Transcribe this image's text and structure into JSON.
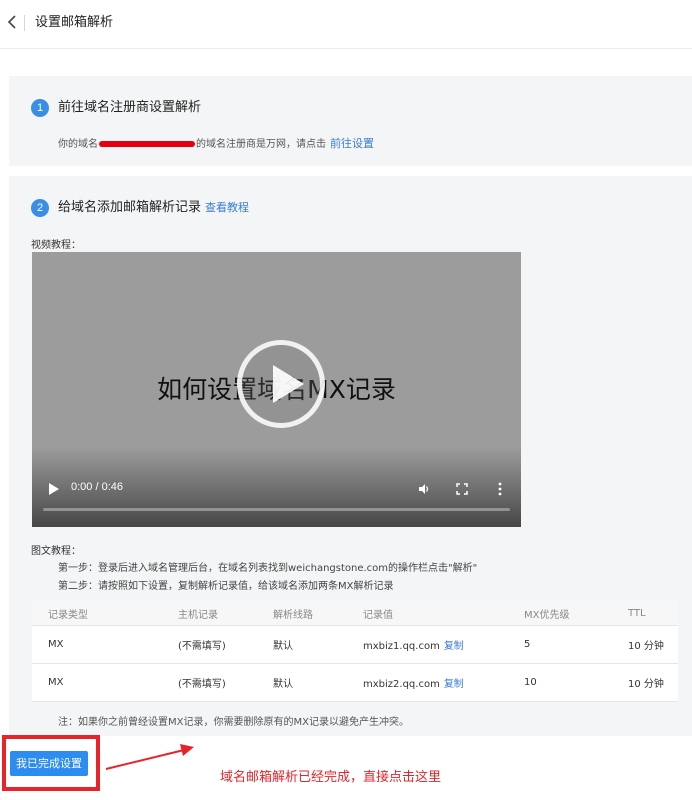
{
  "header": {
    "title": "设置邮箱解析"
  },
  "step1": {
    "number": "1",
    "title": "前往域名注册商设置解析",
    "desc_prefix": "你的域名",
    "desc_suffix": "的域名注册商是万网，请点击",
    "link": "前往设置"
  },
  "step2": {
    "number": "2",
    "title": "给域名添加邮箱解析记录",
    "tutorial_link": "查看教程",
    "video_label": "视频教程：",
    "video": {
      "caption": "如何设置域名MX记录",
      "time": "0:00 / 0:46",
      "progress": 0
    },
    "text_label": "图文教程：",
    "step_a": "第一步：登录后进入域名管理后台，在域名列表找到weichangstone.com的操作栏点击\"解析\"",
    "step_b": "第二步：请按照如下设置，复制解析记录值，给该域名添加两条MX解析记录",
    "table": {
      "headers": [
        "记录类型",
        "主机记录",
        "解析线路",
        "记录值",
        "MX优先级",
        "TTL"
      ],
      "copy_label": "复制",
      "rows": [
        [
          "MX",
          "(不需填写)",
          "默认",
          "mxbiz1.qq.com",
          "5",
          "10 分钟"
        ],
        [
          "MX",
          "(不需填写)",
          "默认",
          "mxbiz2.qq.com",
          "10",
          "10 分钟"
        ]
      ]
    },
    "note": "注：如果你之前曾经设置MX记录，你需要删除原有的MX记录以避免产生冲突。"
  },
  "footer": {
    "done_button": "我已完成设置",
    "annotation": "域名邮箱解析已经完成，直接点击这里"
  },
  "colors": {
    "accent": "#2d8cf0",
    "link": "#3a7bd5",
    "annotation": "#e8242a",
    "redaction": "#e60012"
  },
  "icons": [
    "back-chevron-icon",
    "play-icon",
    "volume-icon",
    "fullscreen-icon",
    "more-vertical-icon",
    "arrow-icon"
  ]
}
